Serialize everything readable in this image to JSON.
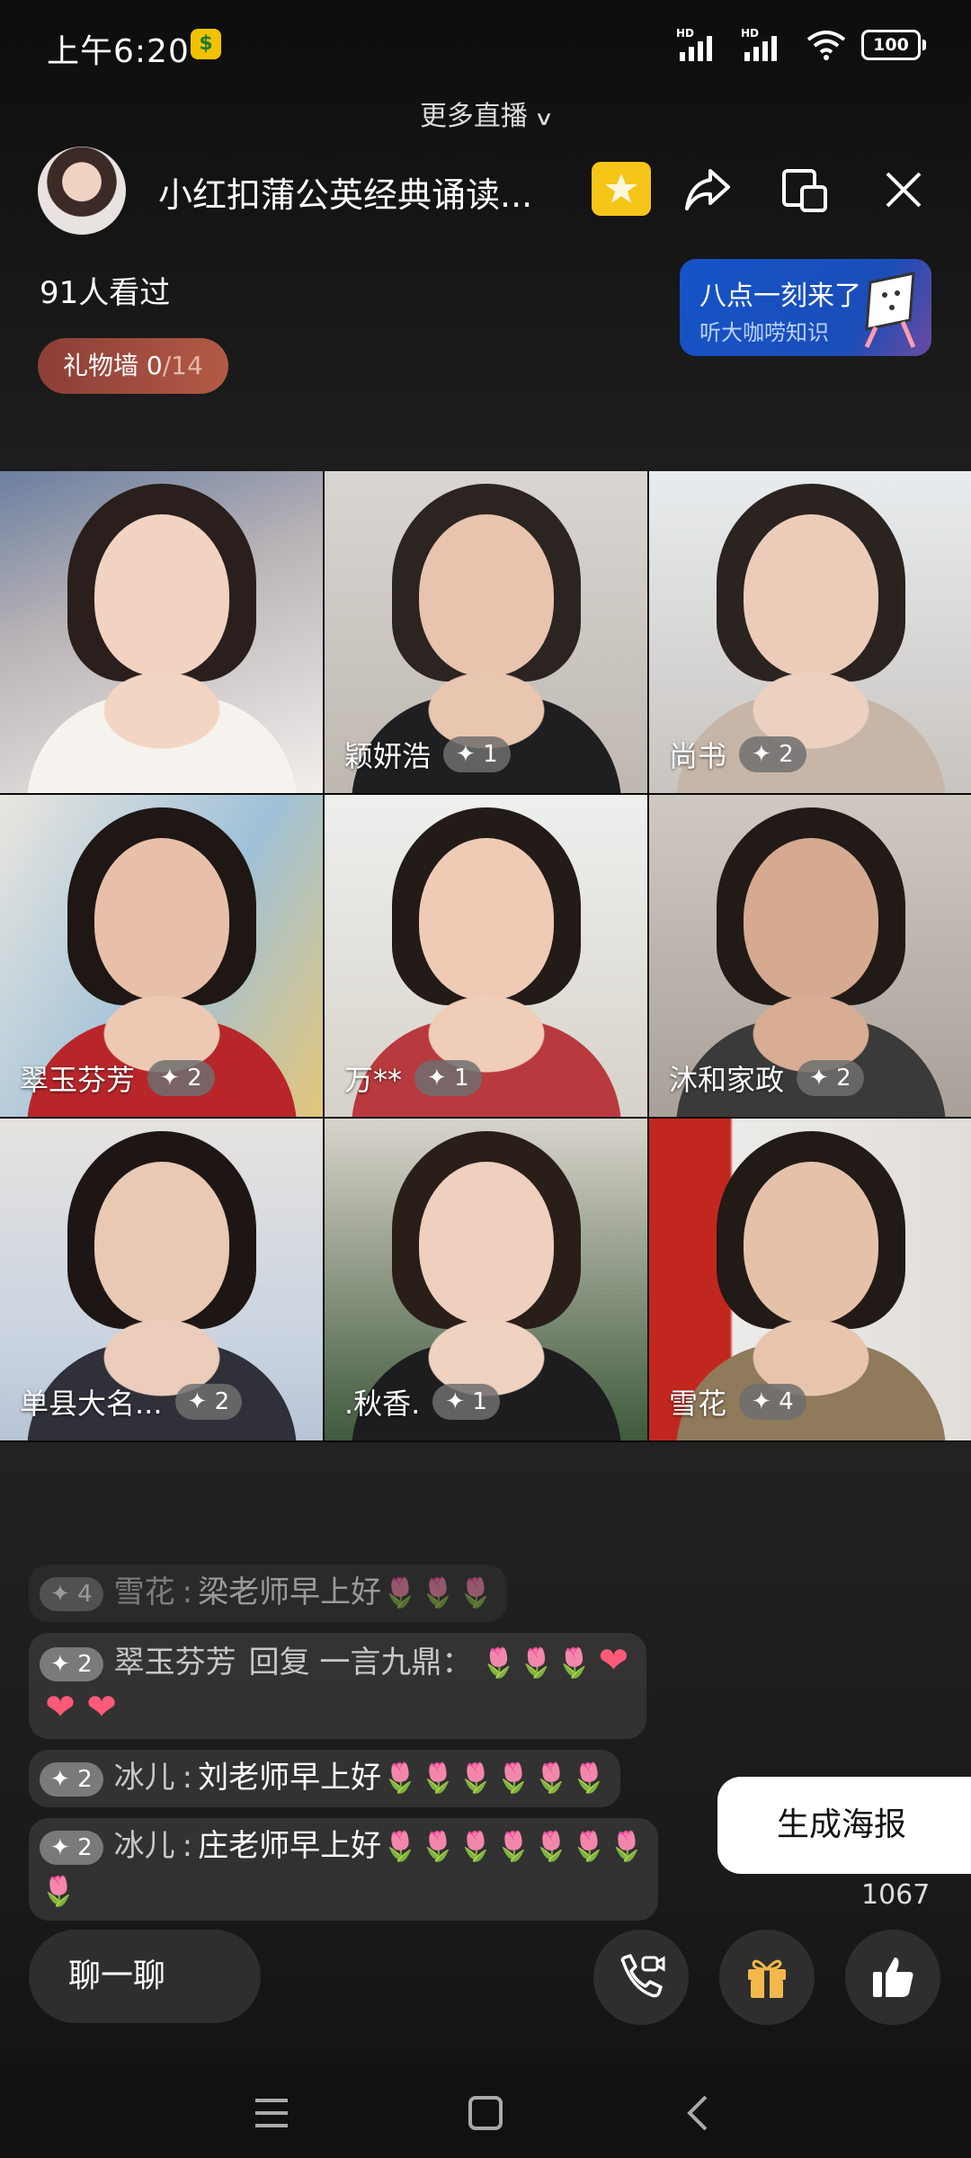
{
  "status_bar": {
    "time": "上午6:20",
    "network_label_1": "HD",
    "network_label_2": "HD",
    "battery": "100"
  },
  "more_live": "更多直播",
  "header": {
    "title": "小红扣蒲公英经典诵读...",
    "viewers": "91人看过",
    "gift_wall_label": "礼物墙",
    "gift_wall_count": "0",
    "gift_wall_total": "/14"
  },
  "promo": {
    "line1": "八点一刻来了",
    "line2": "听大咖唠知识"
  },
  "tiles": [
    {
      "name": "",
      "level": ""
    },
    {
      "name": "颖妍浩",
      "level": "1"
    },
    {
      "name": "尚书",
      "level": "2"
    },
    {
      "name": "翠玉芬芳",
      "level": "2"
    },
    {
      "name": "万**",
      "level": "1"
    },
    {
      "name": "沐和家政",
      "level": "2"
    },
    {
      "name": "单县大名...",
      "level": "2"
    },
    {
      "name": ".秋香.",
      "level": "1"
    },
    {
      "name": "雪花",
      "level": "4"
    }
  ],
  "level_prefix": "✦",
  "chat": [
    {
      "level": "4",
      "user": "雪花",
      "sep": ":",
      "text": "梁老师早上好",
      "tulips": 3,
      "hearts": 0
    },
    {
      "level": "2",
      "user": "翠玉芬芳",
      "sep": "",
      "text": "回复 一言九鼎：",
      "tulips": 3,
      "hearts": 3
    },
    {
      "level": "2",
      "user": "冰儿",
      "sep": ":",
      "text": "刘老师早上好",
      "tulips": 6,
      "hearts": 0
    },
    {
      "level": "2",
      "user": "冰儿",
      "sep": ":",
      "text": "庄老师早上好",
      "tulips": 8,
      "hearts": 0
    }
  ],
  "poster_button": "生成海报",
  "like_count": "1067",
  "chat_input": "聊一聊",
  "icons": {
    "favorite": "star-icon",
    "share": "share-icon",
    "floating_window": "pip-icon",
    "close": "close-icon",
    "call": "video-call-icon",
    "gift": "gift-icon",
    "like": "thumbs-up-icon",
    "nav_menu": "menu-icon",
    "nav_home": "home-icon",
    "nav_back": "back-icon"
  },
  "colors": {
    "gift_wall": "#a04c40",
    "promo": "#1554c8",
    "favorite": "#f5c518",
    "tulip": "#e33333",
    "heart": "#ff5a78"
  }
}
